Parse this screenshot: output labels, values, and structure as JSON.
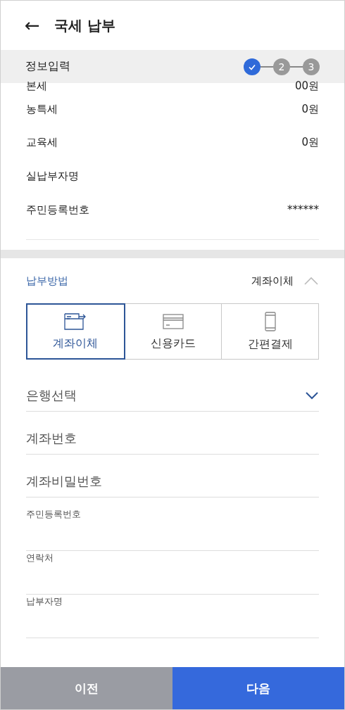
{
  "header": {
    "back": "←",
    "title": "국세 납부"
  },
  "stepbar": {
    "label": "정보입력",
    "steps": [
      {
        "done": true
      },
      {
        "done": false,
        "label": "2"
      },
      {
        "done": false,
        "label": "3"
      }
    ]
  },
  "summary": [
    {
      "label": "본세",
      "value": "00원"
    },
    {
      "label": "농특세",
      "value": "0원"
    },
    {
      "label": "교육세",
      "value": "0원"
    },
    {
      "label": "실납부자명"
    },
    {
      "label": "주민등록번호",
      "value": "******"
    }
  ],
  "payment": {
    "title": "납부방법",
    "current": "계좌이체",
    "expanded": true,
    "methods": [
      {
        "kind": "transfer",
        "label": "계좌이체",
        "selected": true
      },
      {
        "kind": "card",
        "label": "신용카드",
        "selected": false
      },
      {
        "kind": "phone",
        "label": "간편결제",
        "selected": false
      }
    ]
  },
  "fields": [
    {
      "kind": "select",
      "placeholder": "은행선택"
    },
    {
      "kind": "input",
      "placeholder": "계좌번호"
    },
    {
      "kind": "input",
      "placeholder": "계좌비밀번호"
    },
    {
      "kind": "labeled",
      "label": "주민등록번호"
    },
    {
      "kind": "labeled",
      "label": "연락처"
    },
    {
      "kind": "labeled",
      "label": "납부자명"
    }
  ],
  "buttons": [
    {
      "kind": "secondary",
      "label": "이전"
    },
    {
      "kind": "primary",
      "label": "다음"
    }
  ]
}
